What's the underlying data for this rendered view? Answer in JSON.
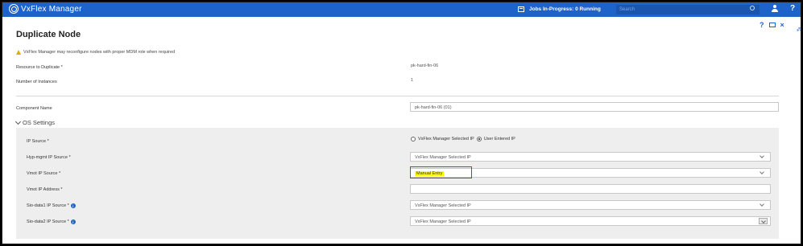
{
  "topbar": {
    "app_title": "VxFlex Manager",
    "jobs_label": "Jobs In-Progress: 0 Running",
    "search_placeholder": "Search",
    "help_label": "?"
  },
  "modal": {
    "title": "Duplicate Node",
    "controls": {
      "help": "?",
      "close": "×"
    },
    "warning": "VxFlex Manager may reconfigure nodes with proper MDM role when required",
    "resource_label": "Resource to Duplicate *",
    "resource_value": "pk-hard-fin-06",
    "instances_label": "Number of Instances",
    "instances_value": "1",
    "component_label": "Component Name",
    "component_value": "pk-hard-fin-06 (01)",
    "os_section": {
      "title": "OS Settings",
      "ip_source_label": "IP Source *",
      "radio_options": [
        "VxFlex Manager Selected IP",
        "User Entered IP"
      ],
      "radio_selected": "User Entered IP",
      "hyp_label": "Hyp-mgmt IP Source *",
      "hyp_value": "VxFlex Manager Selected IP",
      "vmot_source_label": "Vmot IP Source *",
      "vmot_source_value": "Manual Entry",
      "vmot_address_label": "Vmot IP Address *",
      "vmot_address_value": "",
      "sio1_label": "Sio-data1 IP Source *",
      "sio1_value": "VxFlex Manager Selected IP",
      "sio2_label": "Sio-data2 IP Source *",
      "sio2_value": "VxFlex Manager Selected IP"
    }
  },
  "colors": {
    "brand_blue": "#1e63c9",
    "highlight_yellow": "#ffff00",
    "annotation_red": "#e0241b",
    "warning_amber": "#e8a800"
  }
}
